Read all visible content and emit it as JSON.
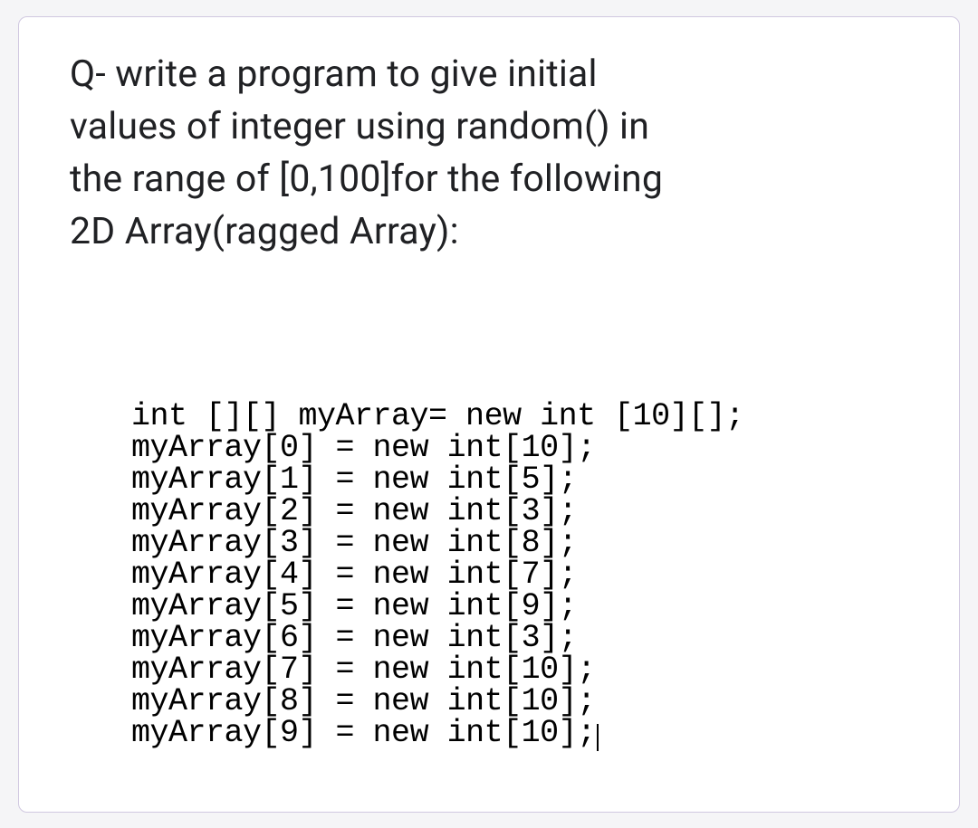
{
  "question": {
    "line1": "Q- write a program to give initial",
    "line2": "values of integer using random() in",
    "line3": "the range of [0,100]for the following",
    "line4": "2D Array(ragged Array):"
  },
  "code": {
    "declaration": "int [][] myArray= new int [10][];",
    "rows": [
      {
        "lhs": "myArray[0]",
        "rhs": " = new int[10];"
      },
      {
        "lhs": "myArray[1]",
        "rhs": " = new int[5];"
      },
      {
        "lhs": "myArray[2]",
        "rhs": " = new int[3];"
      },
      {
        "lhs": "myArray[3]",
        "rhs": " = new int[8];"
      },
      {
        "lhs": "myArray[4]",
        "rhs": " = new int[7];"
      },
      {
        "lhs": "myArray[5]",
        "rhs": " = new int[9];"
      },
      {
        "lhs": "myArray[6]",
        "rhs": " = new int[3];"
      },
      {
        "lhs": "myArray[7]",
        "rhs": " = new int[10];"
      },
      {
        "lhs": "myArray[8]",
        "rhs": " = new int[10];"
      },
      {
        "lhs": "myArray[9]",
        "rhs": " = new int[10];"
      }
    ]
  }
}
